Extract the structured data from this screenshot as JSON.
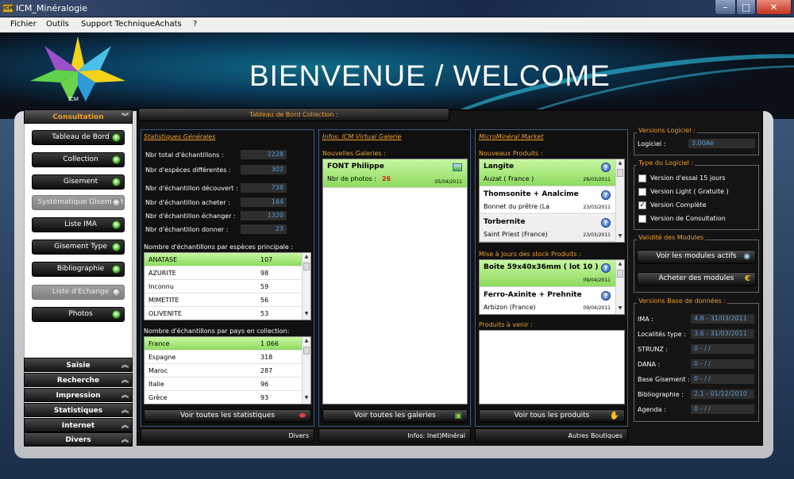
{
  "window": {
    "title": "ICM_Minéralogie",
    "icon_text": "ICM",
    "min": "–",
    "max": "□",
    "close": "✕"
  },
  "menu": [
    "Fichier",
    "Outils",
    "Support Technique",
    "Achats",
    "?"
  ],
  "banner": {
    "title": "BIENVENUE / WELCOME",
    "logo_text": "ICM"
  },
  "nav": {
    "consultation": "Consultation",
    "chevron_up": "︽",
    "chevron_down": "︾",
    "buttons": [
      "Tableau de Bord",
      "Collection",
      "Gisement",
      "Systématique Gisement",
      "Liste IMA",
      "Gisement Type",
      "Bibliographie",
      "Liste d'Echange",
      "Photos"
    ],
    "sections": [
      "Saisie",
      "Recherche",
      "Impression",
      "Statistiques",
      "Internet",
      "Divers"
    ]
  },
  "dashboard": {
    "tab": "Tableau de Bord Collection :",
    "stats": {
      "header": "Statistiques Générales",
      "rows": [
        {
          "label": "Nbr total d'échantillons :",
          "value": "2228"
        },
        {
          "label": "Nbr d'espèces différentes :",
          "value": "302"
        },
        {
          "label": "Nbr d'échantillon découvert :",
          "value": "738"
        },
        {
          "label": "Nbr d'échantillon acheter :",
          "value": "144"
        },
        {
          "label": "Nbr d'échantillon échanger :",
          "value": "1320"
        },
        {
          "label": "Nbr d'échantillon donner :",
          "value": "23"
        }
      ],
      "species_title": "Nombre d'échantillons par espèces principale :",
      "species": [
        {
          "name": "ANATASE",
          "count": "107"
        },
        {
          "name": "AZURITE",
          "count": "98"
        },
        {
          "name": "Inconnu",
          "count": "59"
        },
        {
          "name": "MIMETITE",
          "count": "56"
        },
        {
          "name": "OLIVENITE",
          "count": "53"
        }
      ],
      "country_title": "Nombre d'échantillons par pays en collection:",
      "countries": [
        {
          "name": "France",
          "count": "1 066"
        },
        {
          "name": "Espagne",
          "count": "318"
        },
        {
          "name": "Maroc",
          "count": "287"
        },
        {
          "name": "Italie",
          "count": "96"
        },
        {
          "name": "Grèce",
          "count": "93"
        }
      ],
      "button": "Voir toutes les statistiques",
      "footer": "Divers"
    },
    "gallery": {
      "header": "Infos: ICM Virtual Galerie",
      "sub": "Nouvelles Galeries :",
      "item": {
        "name": "FONT Philippe",
        "label": "Nbr de photos :",
        "count": "26",
        "date": "05/04/2011"
      },
      "button": "Voir toutes les galeries",
      "footer": "Infos: Inet)Minéral"
    },
    "market": {
      "header": "MicroMinéral Market",
      "sub1": "Nouveaux Produits :",
      "products": [
        {
          "name": "Langite",
          "loc": "Auzat ( France )",
          "date": "26/03/2011"
        },
        {
          "name": "Thomsonite + Analcime",
          "loc": "Bonnet du prêtre (La",
          "date": "23/03/2011"
        },
        {
          "name": "Torbernite",
          "loc": "Saint Priest (France)",
          "date": "23/03/2011"
        }
      ],
      "sub2": "Mise à Jours des stock Produits :",
      "stock": [
        {
          "name": "Boite 59x40x36mm ( lot 10 )",
          "loc": "",
          "date": "09/04/2011"
        },
        {
          "name": "Ferro-Axinite + Prehnite",
          "loc": "Arbizon (France)",
          "date": "09/04/2011"
        }
      ],
      "sub3": "Produits à venir :",
      "button": "Voir tous les produits",
      "footer": "Autres Boutiques"
    },
    "right": {
      "versions_title": "Versions Logiciel :",
      "logiciel_label": "Logiciel :",
      "logiciel_value": "3.00Ae",
      "type_title": "Type du Logiciel :",
      "types": [
        {
          "label": "Version d'essai 15 jours",
          "checked": false
        },
        {
          "label": "Version Light ( Gratuite )",
          "checked": false
        },
        {
          "label": "Version Complète",
          "checked": true
        },
        {
          "label": "Version de Consultation",
          "checked": false
        }
      ],
      "modules_title": "Validité des Modules",
      "btn_modules": "Voir les modules actifs",
      "btn_buy": "Acheter des modules",
      "euro": "€",
      "db_title": "Versions Base de données :",
      "db": [
        {
          "label": "IMA :",
          "value": "4.8 - 31/03/2011"
        },
        {
          "label": "Localités type :",
          "value": "3.6 - 31/03/2011"
        },
        {
          "label": "STRUNZ :",
          "value": "0 - / /"
        },
        {
          "label": "DANA :",
          "value": "0 - / /"
        },
        {
          "label": "Base Gisement :",
          "value": "0 - / /"
        },
        {
          "label": "Bibliographie :",
          "value": "2.1 - 01/12/2010"
        },
        {
          "label": "Agenda :",
          "value": "0 - / /"
        }
      ]
    }
  },
  "glyphs": {
    "check": "✓",
    "q": "?",
    "up": "▲",
    "dn": "▼"
  },
  "colors": {
    "accent": "#f0a030",
    "value_blue": "#5a9bd8",
    "selected_green": "#8ddb5e",
    "red_count": "#d02020"
  }
}
